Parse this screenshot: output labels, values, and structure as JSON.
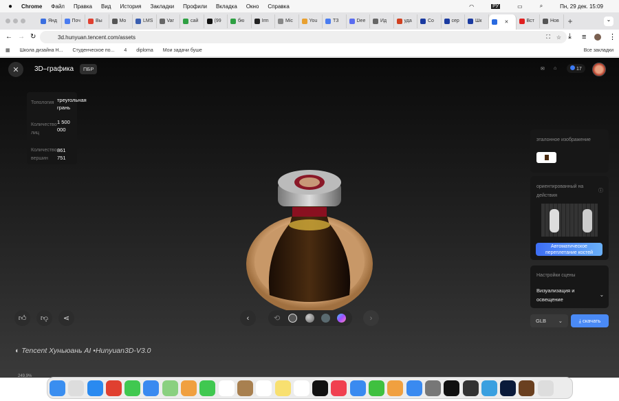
{
  "menubar": {
    "app": "Chrome",
    "items": [
      "Файл",
      "Правка",
      "Вид",
      "История",
      "Закладки",
      "Профили",
      "Вкладка",
      "Окно",
      "Справка"
    ],
    "lang": "РУ",
    "datetime": "Пн, 29 дек.  15:09"
  },
  "tabs": [
    {
      "label": "Янд",
      "color": "#3b6fe0"
    },
    {
      "label": "Поч",
      "color": "#4a7cf0"
    },
    {
      "label": "Вы",
      "color": "#e04030"
    },
    {
      "label": "Мо",
      "color": "#555"
    },
    {
      "label": "LMS",
      "color": "#3a5eb0"
    },
    {
      "label": "Var",
      "color": "#666"
    },
    {
      "label": "сай",
      "color": "#2ea043"
    },
    {
      "label": "(99",
      "color": "#111"
    },
    {
      "label": "бю",
      "color": "#2ea043"
    },
    {
      "label": "Irm",
      "color": "#222"
    },
    {
      "label": "Mic",
      "color": "#888"
    },
    {
      "label": "You",
      "color": "#e8a030"
    },
    {
      "label": "ТЗ",
      "color": "#4a7cf0"
    },
    {
      "label": "Dee",
      "color": "#5a6cf0"
    },
    {
      "label": "Ид",
      "color": "#666"
    },
    {
      "label": "уда",
      "color": "#d04020"
    },
    {
      "label": "Со",
      "color": "#1a3aa0"
    },
    {
      "label": "сер",
      "color": "#1a3aa0"
    },
    {
      "label": "Шк",
      "color": "#1a3aa0"
    },
    {
      "label": "",
      "color": "#2a6ae0",
      "active": true
    },
    {
      "label": "Вст",
      "color": "#e02020"
    },
    {
      "label": "Нов",
      "color": "#555"
    }
  ],
  "address": {
    "url": "3d.hunyuan.tencent.com/assets"
  },
  "bookmarks": [
    "Школа дизайна Н...",
    "Студенческое по...",
    "4",
    "diploma",
    "Мои задачи буше"
  ],
  "all_bookmarks": "Все закладки",
  "app": {
    "title": "3D–графика",
    "badge": "ПБР",
    "credits": "17",
    "info": {
      "topology_label": "Топология",
      "topology_value": "треугольная грань",
      "faces_label": "Количество лиц",
      "faces_value": "1 500 000",
      "verts_label": "Количество вершин",
      "verts_value": "861 751"
    },
    "reference_label": "эталонное изображение",
    "action_label": "ориентированный на действия",
    "rig_button": "Автоматическое переплетание костей",
    "scene_label": "Настройки сцены",
    "scene_value": "Визуализация и освещение",
    "format": "GLB",
    "download": "скачать",
    "brand": "Tencent Хуньюань AI •Hunyuan3D-V3.0",
    "accent": "#3d7bf5"
  },
  "dock_status": "249,9%"
}
